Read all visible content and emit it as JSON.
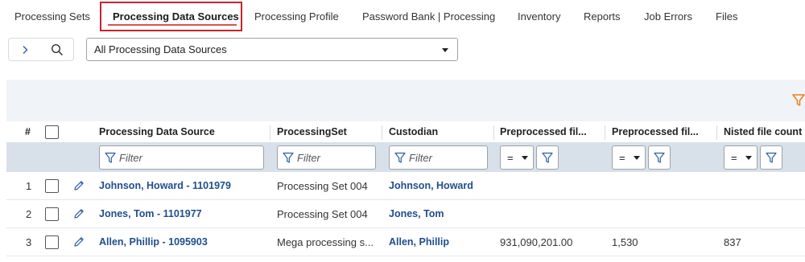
{
  "tabs": [
    {
      "label": "Processing Sets",
      "active": false
    },
    {
      "label": "Processing Data Sources",
      "active": true
    },
    {
      "label": "Processing Profile",
      "active": false
    },
    {
      "label": "Password Bank | Processing",
      "active": false
    },
    {
      "label": "Inventory",
      "active": false
    },
    {
      "label": "Reports",
      "active": false
    },
    {
      "label": "Job Errors",
      "active": false
    },
    {
      "label": "Files",
      "active": false
    }
  ],
  "toolbar": {
    "view_select_value": "All Processing Data Sources",
    "expand_icon": "chevron-right-icon",
    "search_icon": "search-icon"
  },
  "grid": {
    "columns": {
      "index": "#",
      "name": "Processing Data Source",
      "set": "ProcessingSet",
      "custodian": "Custodian",
      "pre1": "Preprocessed fil...",
      "pre2": "Preprocessed fil...",
      "nisted": "Nisted file count"
    },
    "filter_placeholder": "Filter",
    "operator": "=",
    "rows": [
      {
        "index": "1",
        "name": "Johnson, Howard - 1101979",
        "set": "Processing Set 004",
        "custodian": "Johnson, Howard",
        "pre1": "",
        "pre2": "",
        "nisted": ""
      },
      {
        "index": "2",
        "name": "Jones, Tom - 1101977",
        "set": "Processing Set 004",
        "custodian": "Jones, Tom",
        "pre1": "",
        "pre2": "",
        "nisted": ""
      },
      {
        "index": "3",
        "name": "Allen, Phillip - 1095903",
        "set": "Mega processing s...",
        "custodian": "Allen, Phillip",
        "pre1": "931,090,201.00",
        "pre2": "1,530",
        "nisted": "837"
      }
    ]
  },
  "colors": {
    "active_tab_border": "#c8232c",
    "link": "#1f4e8c",
    "filter_row_bg": "#d8e0ea",
    "panel_bg": "#f0f4f8",
    "accent_orange": "#f07d1a"
  }
}
